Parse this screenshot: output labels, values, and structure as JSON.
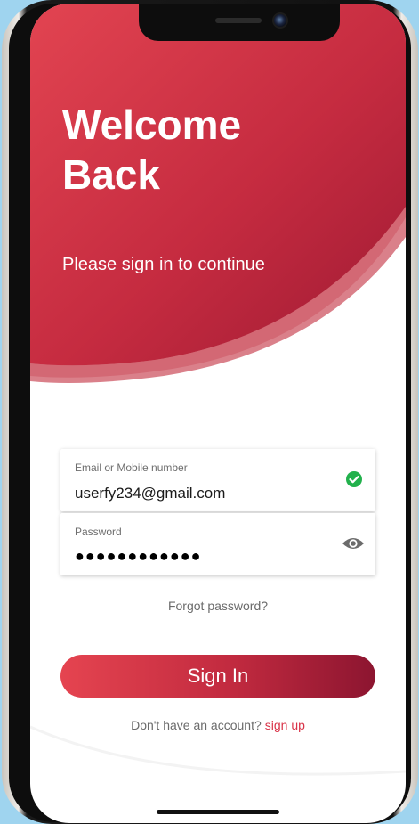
{
  "header": {
    "title_line1": "Welcome",
    "title_line2": "Back",
    "subtitle": "Please sign in to continue"
  },
  "form": {
    "email": {
      "label": "Email or Mobile number",
      "value": "userfy234@gmail.com",
      "status_icon": "check-circle-icon"
    },
    "password": {
      "label": "Password",
      "masked_value": "●●●●●●●●●●●●",
      "toggle_icon": "eye-icon"
    },
    "forgot_label": "Forgot password?",
    "submit_label": "Sign In"
  },
  "footer": {
    "prompt": "Don't have an account?",
    "signup_label": "sign up"
  },
  "colors": {
    "brand_red": "#d93348",
    "brand_dark": "#8c1530",
    "success_green": "#22b14c",
    "background": "#9fd4ef"
  }
}
